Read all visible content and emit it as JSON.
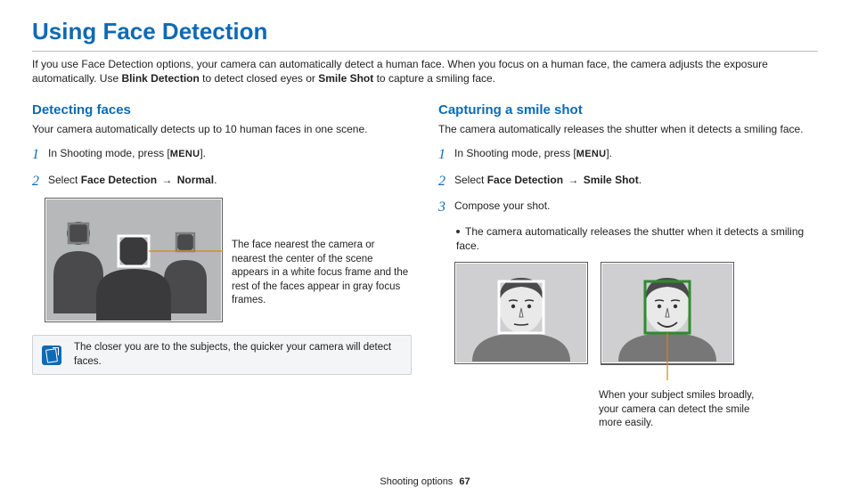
{
  "title": "Using Face Detection",
  "intro": {
    "line1_prefix": "If you use Face Detection options, your camera can automatically detect a human face. When you focus on a human face, the camera adjusts the exposure automatically. Use ",
    "bold1": "Blink Detection",
    "mid": " to detect closed eyes or ",
    "bold2": "Smile Shot",
    "suffix": " to capture a smiling face."
  },
  "left": {
    "header": "Detecting faces",
    "intro": "Your camera automatically detects up to 10 human faces in one scene.",
    "step1_prefix": "In Shooting mode, press [",
    "step1_menu": "MENU",
    "step1_suffix": "].",
    "step2_prefix": "Select ",
    "step2_b1": "Face Detection",
    "step2_arrow": " → ",
    "step2_b2": "Normal",
    "step2_suffix": ".",
    "callout": "The face nearest the camera or nearest the center of the scene appears in a white focus frame and the rest of the faces appear in gray focus frames.",
    "note": "The closer you are to the subjects, the quicker your camera will detect faces."
  },
  "right": {
    "header": "Capturing a smile shot",
    "intro": "The camera automatically releases the shutter when it detects a smiling face.",
    "step1_prefix": "In Shooting mode, press [",
    "step1_menu": "MENU",
    "step1_suffix": "].",
    "step2_prefix": "Select ",
    "step2_b1": "Face Detection",
    "step2_arrow": " → ",
    "step2_b2": "Smile Shot",
    "step2_suffix": ".",
    "step3": "Compose your shot.",
    "substep": "The camera automatically releases the shutter when it detects a smiling face.",
    "smile_callout": "When your subject smiles broadly, your camera can detect the smile more easily."
  },
  "footer": {
    "section": "Shooting options",
    "page": "67"
  }
}
